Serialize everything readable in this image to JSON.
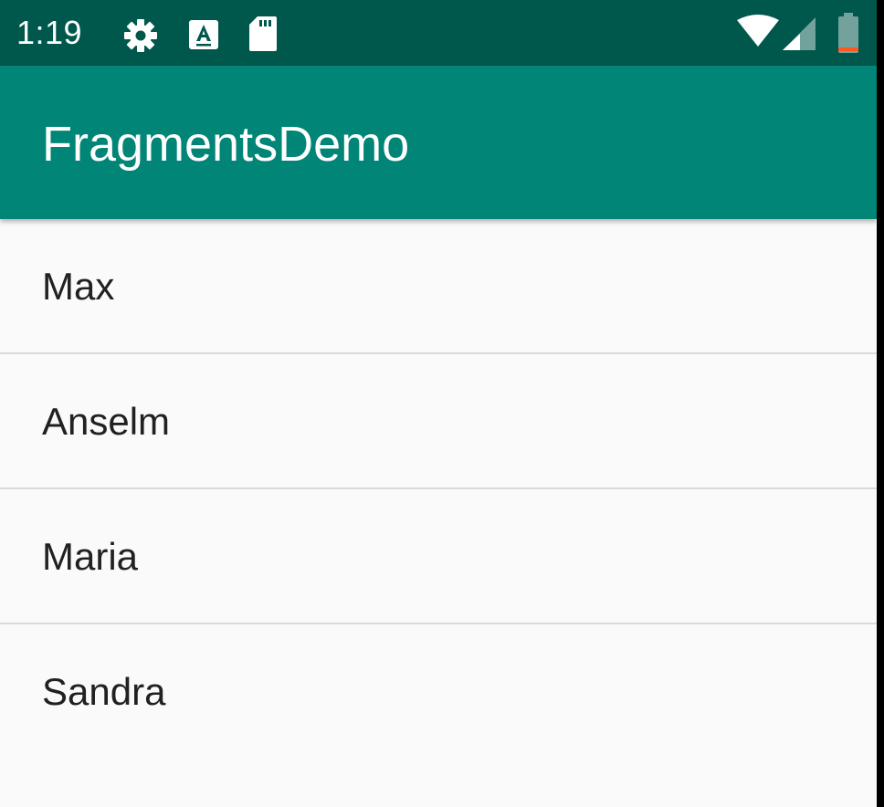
{
  "status_bar": {
    "time": "1:19",
    "icons": [
      "gear-icon",
      "keyboard-a-icon",
      "sd-card-icon",
      "wifi-icon",
      "cellular-signal-icon",
      "battery-icon"
    ],
    "background_color": "#00574b"
  },
  "app_bar": {
    "title": "FragmentsDemo",
    "background_color": "#008577"
  },
  "list": {
    "items": [
      {
        "label": "Max"
      },
      {
        "label": "Anselm"
      },
      {
        "label": "Maria"
      },
      {
        "label": "Sandra"
      }
    ]
  },
  "colors": {
    "background": "#fafafa",
    "text": "#212121",
    "divider": "#dadada",
    "battery_low": "#ff5722"
  }
}
